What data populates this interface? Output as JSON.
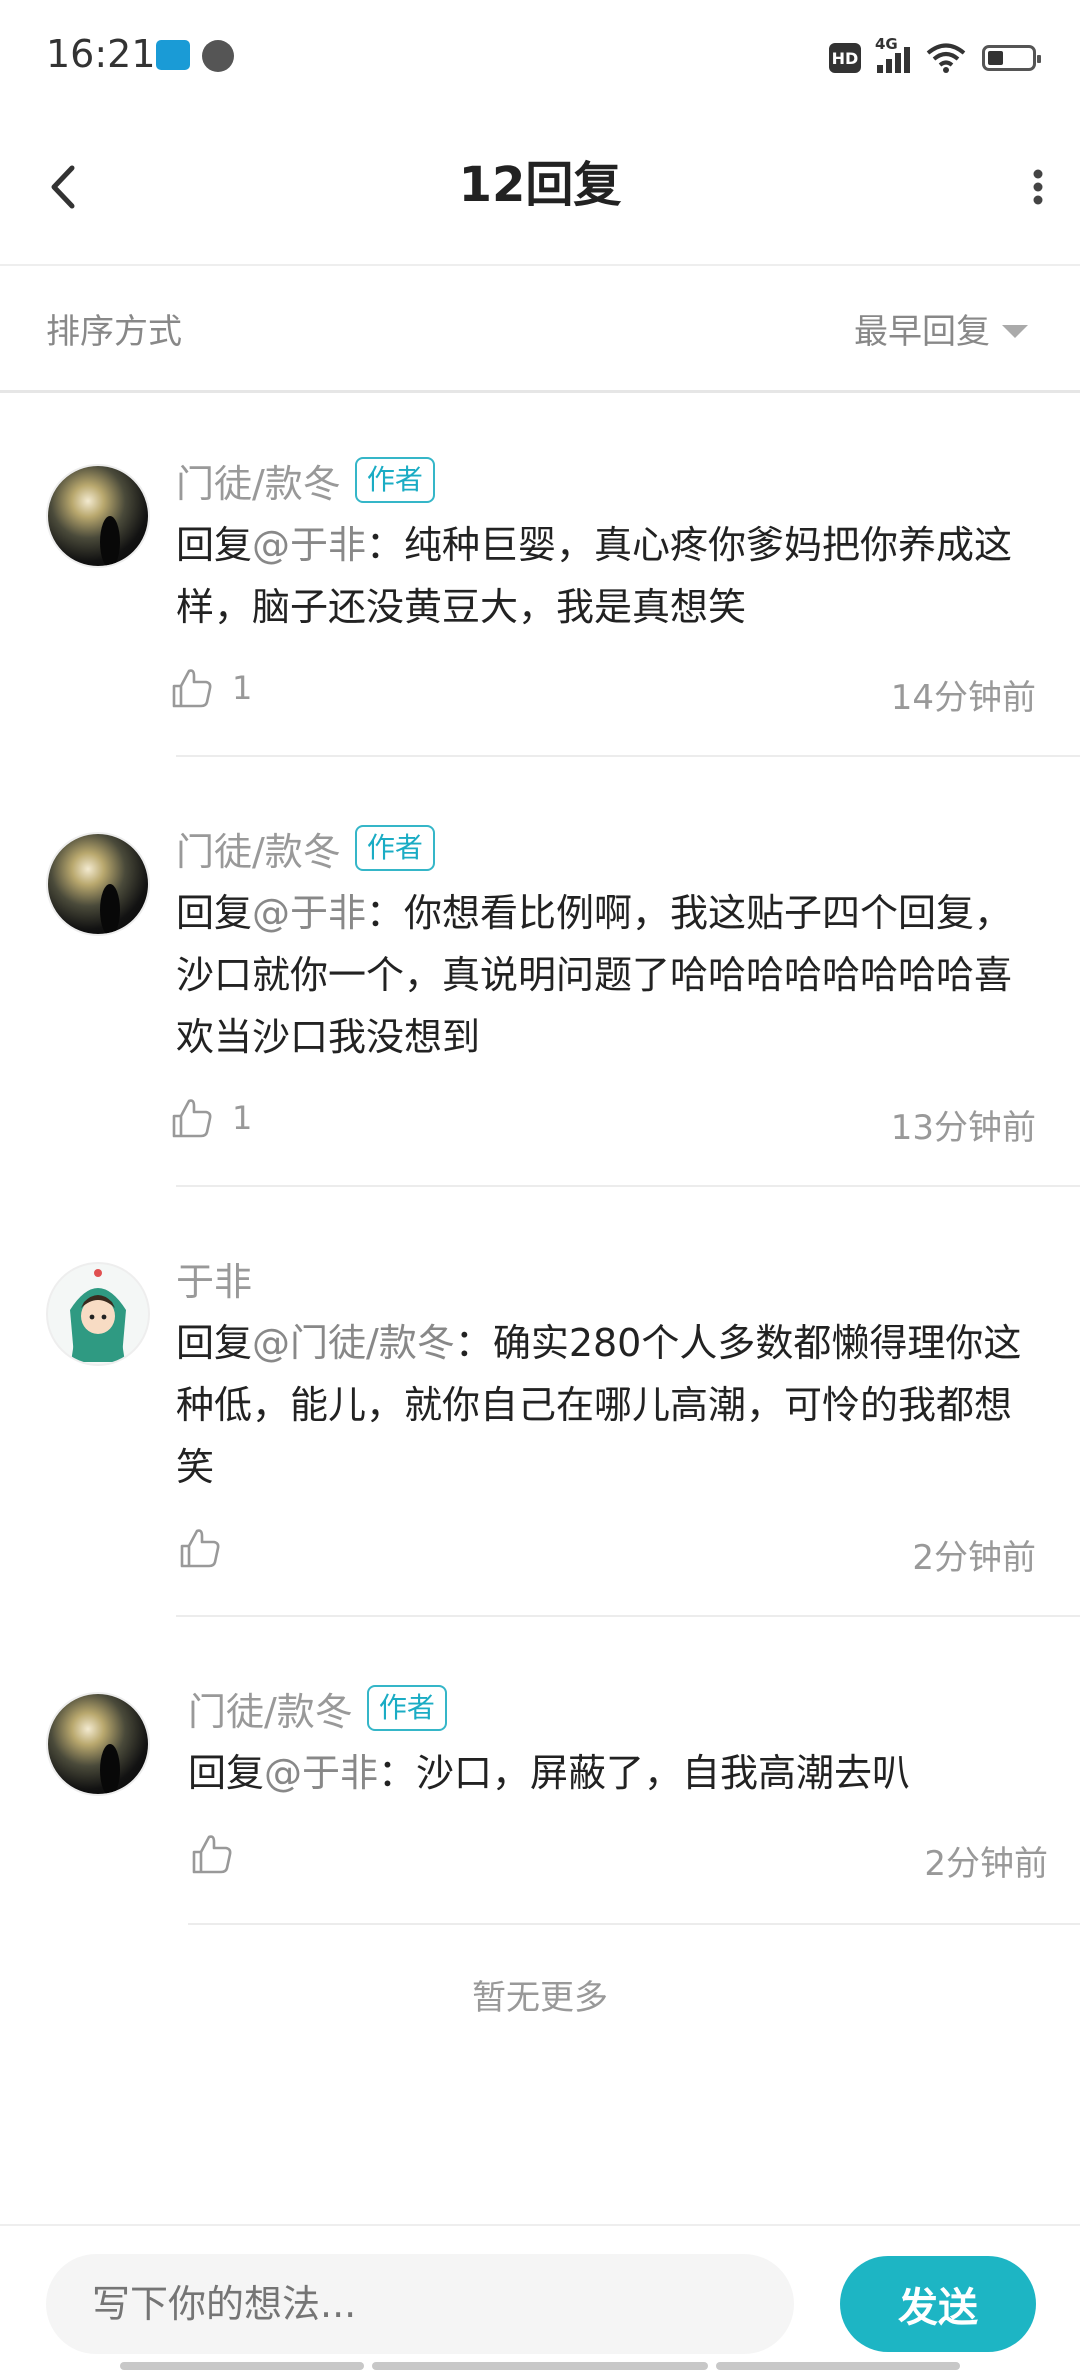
{
  "status_bar": {
    "time": "16:21",
    "hd": "HD",
    "network": "4G",
    "battery_level": 0.35
  },
  "header": {
    "title": "12回复",
    "back_icon": "chevron-left-icon",
    "more_icon": "more-vertical-icon"
  },
  "sort": {
    "label": "排序方式",
    "value": "最早回复"
  },
  "comments": [
    {
      "author": "门徒/款冬",
      "author_tag": "作者",
      "avatar": "sunset-photo",
      "reply_prefix": "回复",
      "mention": "@于非",
      "text": "：纯种巨婴，真心疼你爹妈把你养成这样，脑子还没黄豆大，我是真想笑",
      "likes": "1",
      "time": "14分钟前"
    },
    {
      "author": "门徒/款冬",
      "author_tag": "作者",
      "avatar": "sunset-photo",
      "reply_prefix": "回复",
      "mention": "@于非",
      "text": "：你想看比例啊，我这贴子四个回复，沙口就你一个，真说明问题了哈哈哈哈哈哈哈哈喜欢当沙口我没想到",
      "likes": "1",
      "time": "13分钟前"
    },
    {
      "author": "于非",
      "avatar": "anime-character",
      "reply_prefix": "回复",
      "mention": "@门徒/款冬",
      "text": "：确实280个人多数都懒得理你这种低，能儿，就你自己在哪儿高潮，可怜的我都想笑",
      "time": "2分钟前"
    },
    {
      "author": "门徒/款冬",
      "author_tag": "作者",
      "avatar": "sunset-photo",
      "reply_prefix": "回复",
      "mention": "@于非",
      "text": "：沙口，屏蔽了，自我高潮去叭",
      "time": "2分钟前"
    }
  ],
  "no_more": "暂无更多",
  "input": {
    "placeholder": "写下你的想法...",
    "send_label": "发送"
  },
  "colors": {
    "accent": "#1db5c4",
    "tag": "#1aacc4"
  }
}
